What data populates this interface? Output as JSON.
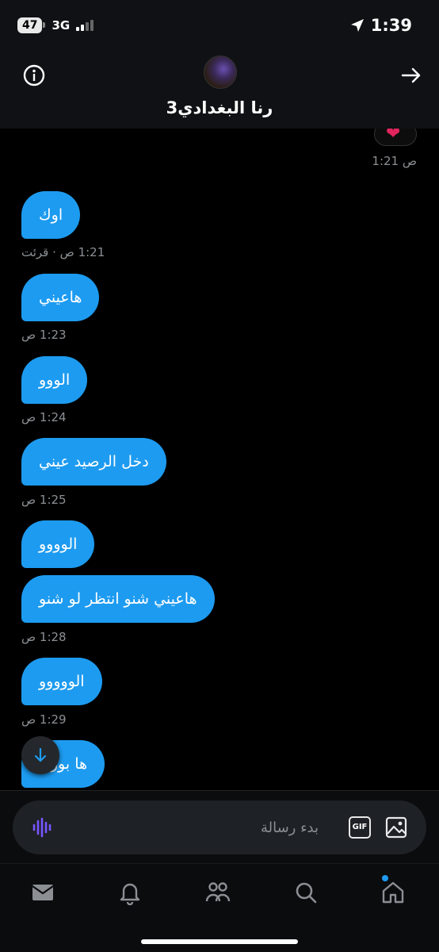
{
  "status_bar": {
    "battery": "47",
    "network": "3G",
    "time": "1:39"
  },
  "header": {
    "contact_name": "رنا البغدادي3"
  },
  "chat": {
    "sent_reaction": "❤",
    "sent_time": "1:21 ص",
    "messages": [
      {
        "text": "اوك",
        "time": "1:21 ص · قرئت"
      },
      {
        "text": "هاعيني",
        "time": "1:23 ص"
      },
      {
        "text": "الووو",
        "time": "1:24 ص"
      },
      {
        "text": "دخل الرصيد عيني",
        "time": "1:25 ص"
      },
      {
        "text": "الوووو",
        "time": ""
      },
      {
        "text": "هاعيني شنو انتظر لو شنو",
        "time": "1:28 ص"
      },
      {
        "text": "الووووو",
        "time": "1:29 ص"
      },
      {
        "text": "ها بوري",
        "time": ""
      }
    ]
  },
  "composer": {
    "placeholder": "بدء رسالة",
    "gif_label": "GIF"
  },
  "icons": {
    "info": "info-icon",
    "back": "arrow-right-icon",
    "voice": "voice-wave-icon",
    "gif": "gif-icon",
    "image": "image-icon",
    "scroll": "arrow-down-icon",
    "tabs": [
      "mail-icon",
      "bell-icon",
      "people-icon",
      "search-icon",
      "home-icon"
    ]
  },
  "colors": {
    "accent": "#1d9bf0",
    "background": "#000000",
    "surface": "#1e2125",
    "muted": "#8b8f94",
    "heart": "#e0245e"
  }
}
